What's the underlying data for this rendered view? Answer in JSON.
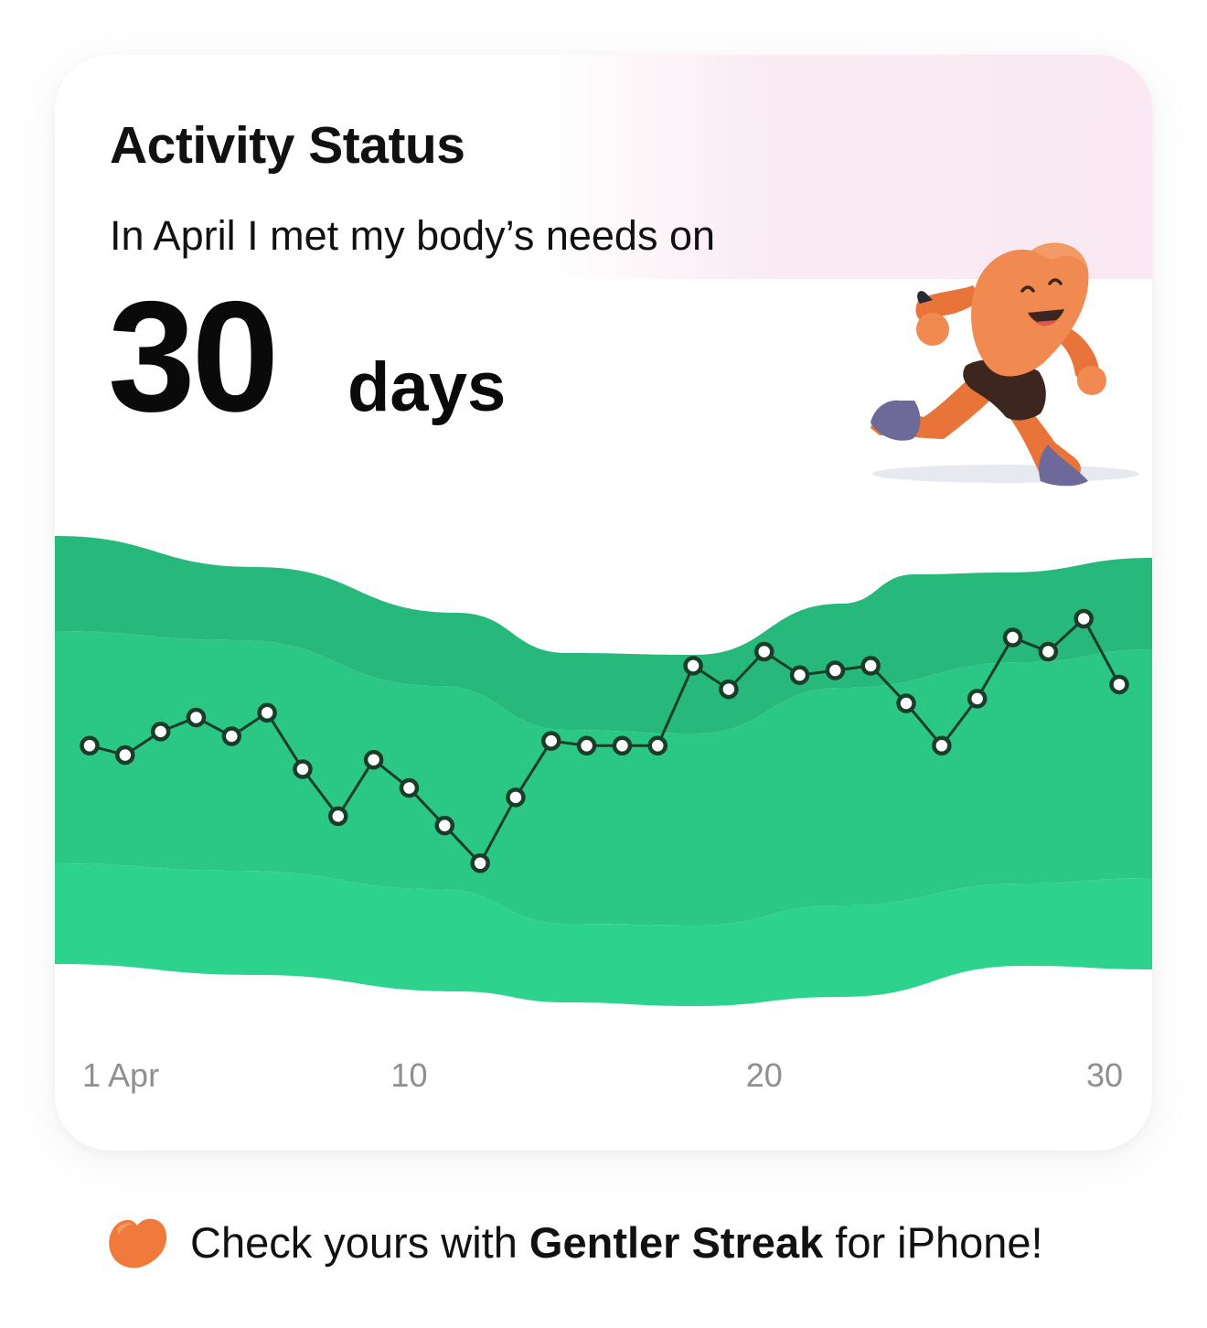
{
  "card": {
    "title": "Activity Status",
    "subtitle": "In April I met my body’s needs on",
    "days_count": "30",
    "days_unit": "days",
    "mascot_icon": "running-heart-mascot-icon"
  },
  "chart_data": {
    "type": "line",
    "title": "",
    "xlabel": "",
    "ylabel": "",
    "x": [
      1,
      2,
      3,
      4,
      5,
      6,
      7,
      8,
      9,
      10,
      11,
      12,
      13,
      14,
      15,
      16,
      17,
      18,
      19,
      20,
      21,
      22,
      23,
      24,
      25,
      26,
      27,
      28,
      29,
      30
    ],
    "x_ticks": [
      {
        "value": 1,
        "label": "1 Apr"
      },
      {
        "value": 10,
        "label": "10"
      },
      {
        "value": 20,
        "label": "20"
      },
      {
        "value": 30,
        "label": "30"
      }
    ],
    "series": [
      {
        "values": [
          48,
          46,
          51,
          54,
          50,
          55,
          43,
          33,
          45,
          39,
          31,
          23,
          37,
          49,
          48,
          48,
          48,
          65,
          60,
          68,
          63,
          64,
          65,
          57,
          48,
          58,
          71,
          68,
          75,
          61
        ],
        "color": "#1a3d2a"
      }
    ],
    "ylim": [
      0,
      100
    ],
    "grid": false,
    "legend": "none",
    "zone_colors": [
      "#27b97b",
      "#2bc785",
      "#2dd38d"
    ]
  },
  "footer": {
    "icon": "gentler-streak-heart-icon",
    "text_pre": "Check yours with ",
    "text_brand": "Gentler Streak",
    "text_post": " for iPhone!"
  },
  "colors": {
    "accent_orange": "#f07a3c",
    "green_dark": "#27b97b",
    "green_mid": "#2bc785",
    "green_light": "#2dd38d",
    "pink": "#f9e8f2"
  }
}
